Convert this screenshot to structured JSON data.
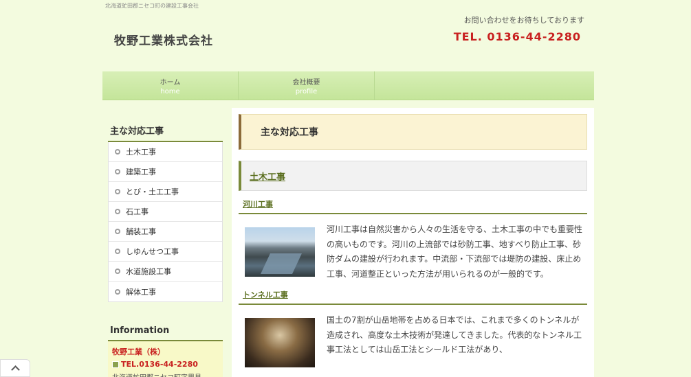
{
  "header": {
    "tagline": "北海道虻田郡ニセコ町の建設工事会社",
    "logo": "牧野工業株式会社",
    "contact_msg": "お問い合わせをお待ちしております",
    "tel": "TEL. 0136-44-2280"
  },
  "nav": [
    {
      "ja": "ホーム",
      "en": "home"
    },
    {
      "ja": "会社概要",
      "en": "profile"
    }
  ],
  "sidebar": {
    "title": "主な対応工事",
    "items": [
      "土木工事",
      "建築工事",
      "とび・土工工事",
      "石工事",
      "舗装工事",
      "しゆんせつ工事",
      "水道施設工事",
      "解体工事"
    ],
    "info_title": "Information",
    "info_company": "牧野工業（株）",
    "info_tel": "TEL.0136-44-2280",
    "info_addr": "北海道虻田郡ニセコ町字里見"
  },
  "main": {
    "h1": "主な対応工事",
    "h2": "土木工事",
    "sections": [
      {
        "title": "河川工事",
        "image": "river-photo",
        "text": "河川工事は自然災害から人々の生活を守る、土木工事の中でも重要性の高いものです。河川の上流部では砂防工事、地すべり防止工事、砂防ダムの建設が行われます。中流部・下流部では堤防の建設、床止め工事、河道整正といった方法が用いられるのが一般的です。"
      },
      {
        "title": "トンネル工事",
        "image": "tunnel-photo",
        "text": "国土の7割が山岳地帯を占める日本では、これまで多くのトンネルが造成され、高度な土木技術が発達してきました。代表的なトンネル工事工法としては山岳工法とシールド工法があり、"
      }
    ]
  },
  "icons": {
    "scroll_top": "chevron-up-icon",
    "tel": "phone-icon"
  }
}
